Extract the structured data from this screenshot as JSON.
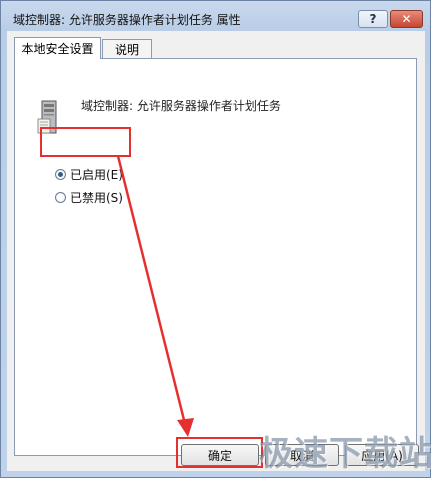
{
  "window": {
    "title": "域控制器: 允许服务器操作者计划任务 属性",
    "help_label": "?",
    "close_label": "✕"
  },
  "tabs": [
    {
      "label": "本地安全设置",
      "active": true
    },
    {
      "label": "说明",
      "active": false
    }
  ],
  "policy": {
    "icon": "server-icon",
    "name": "域控制器: 允许服务器操作者计划任务"
  },
  "options": [
    {
      "label": "已启用(E)",
      "selected": true
    },
    {
      "label": "已禁用(S)",
      "selected": false
    }
  ],
  "buttons": {
    "ok": "确定",
    "cancel": "取消",
    "apply": "应用(A)"
  },
  "watermark": "极速下载站",
  "colors": {
    "highlight": "#e53030",
    "title_bg": "#bfd2ea"
  }
}
